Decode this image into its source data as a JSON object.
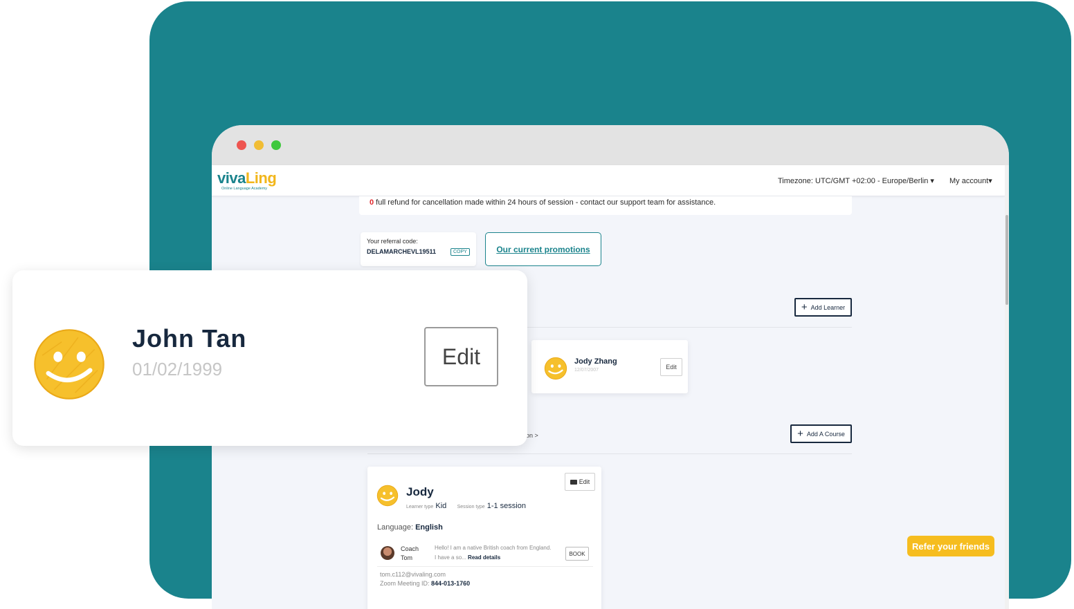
{
  "colors": {
    "teal": "#1a838c",
    "navy": "#17283e",
    "yellow": "#f6bd1f",
    "red": "#e0262a"
  },
  "navbar": {
    "logo_main": "viva",
    "logo_accent": "Ling",
    "logo_sub": "Online Language Academy",
    "timezone": "Timezone: UTC/GMT +02:00 - Europe/Berlin ▾",
    "account": "My account▾"
  },
  "notice": {
    "count": "0",
    "text": " full refund for cancellation made within 24 hours of session - contact our support team for assistance."
  },
  "referral": {
    "label": "Your referral code:",
    "code": "DELAMARCHEVL19511",
    "copy": "COPY",
    "promotions": "Our current promotions"
  },
  "learners": {
    "add_label": "Add Learner",
    "cards": [
      {
        "name": "Jody Zhang",
        "dob": "12/07/2007",
        "edit": "Edit"
      }
    ]
  },
  "courses": {
    "add_label": "Add A Course",
    "partial_link": "ion >",
    "card": {
      "name": "Jody",
      "edit": "Edit",
      "learner_type_label": "Learner type",
      "learner_type": "Kid",
      "session_type_label": "Session type",
      "session_type": "1-1 session",
      "language_label": "Language:",
      "language": "English",
      "coach_line1": "Coach",
      "coach_line2": "Tom",
      "bio_line1": "Hello! I am a native British coach from England.",
      "bio_line2": "I have a so...",
      "read_details": "Read details",
      "book": "BOOK",
      "email": "tom.c112@vivaling.com",
      "zoom_label": "Zoom Meeting ID:",
      "zoom_id": "844-013-1760"
    }
  },
  "refer_button": "Refer your friends",
  "overlay": {
    "name": "John Tan",
    "dob": "01/02/1999",
    "edit": "Edit"
  }
}
